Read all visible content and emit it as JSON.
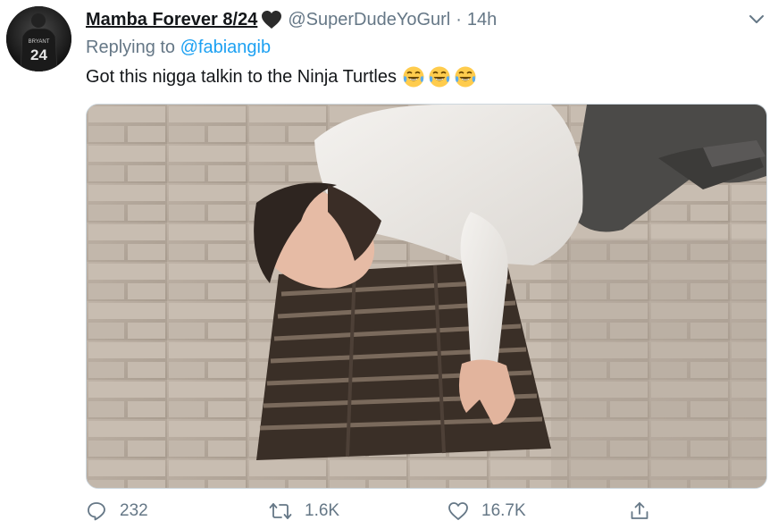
{
  "tweet": {
    "display_name": "Mamba Forever 8/24",
    "handle": "@SuperDudeYoGurl",
    "separator": "·",
    "time": "14h",
    "replying_prefix": "Replying to",
    "replying_to": "@fabiangib",
    "text": "Got this nigga talkin to the Ninja Turtles",
    "emoji": [
      "face-with-tears-of-joy",
      "face-with-tears-of-joy",
      "face-with-tears-of-joy"
    ],
    "avatar_jersey_number": "24",
    "avatar_jersey_name": "BRYANT"
  },
  "actions": {
    "reply_count": "232",
    "retweet_count": "1.6K",
    "like_count": "16.7K"
  },
  "icons": {
    "heart": "black-heart-icon",
    "more": "chevron-down-icon",
    "reply": "reply-icon",
    "retweet": "retweet-icon",
    "like": "like-icon",
    "share": "share-icon"
  },
  "colors": {
    "link": "#1da1f2",
    "secondary_text": "#657786",
    "primary_text": "#14171a"
  }
}
